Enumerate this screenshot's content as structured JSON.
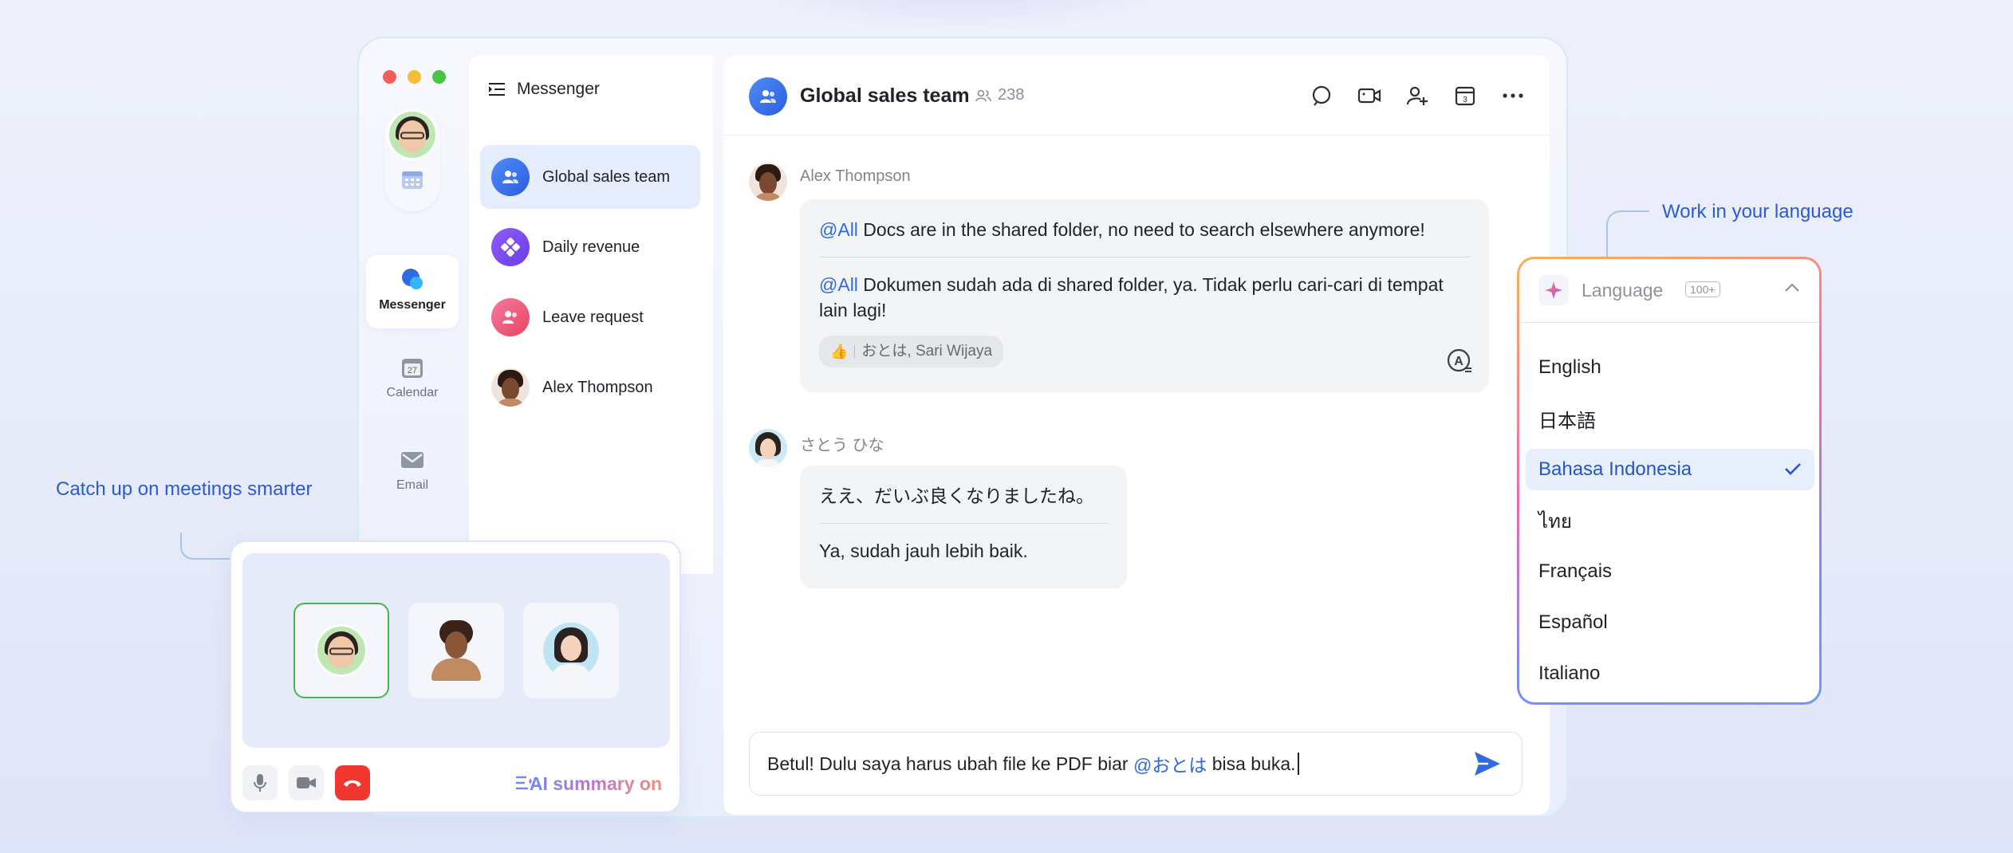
{
  "app": {
    "title": "Messenger",
    "rail": [
      {
        "label": "Messenger",
        "icon": "messenger-icon"
      },
      {
        "label": "Calendar",
        "icon": "calendar-icon",
        "day": "27"
      },
      {
        "label": "Email",
        "icon": "email-icon"
      }
    ]
  },
  "chat_list": [
    {
      "name": "Global sales team",
      "icon": "group-icon",
      "color": "#3a6fe8"
    },
    {
      "name": "Daily revenue",
      "icon": "revenue-icon",
      "color": "#7a4cf0"
    },
    {
      "name": "Leave request",
      "icon": "leave-request-icon",
      "color": "#ee5a7d"
    },
    {
      "name": "Alex Thompson",
      "icon": "avatar"
    }
  ],
  "conversation": {
    "title": "Global sales team",
    "member_count": "238",
    "calendar_day": "3",
    "messages": [
      {
        "sender": "Alex Thompson",
        "mention": "@All",
        "text_original": " Docs are in the shared folder, no need to search elsewhere anymore!",
        "text_translated": " Dokumen sudah ada di shared folder, ya. Tidak perlu cari-cari di tempat lain lagi!",
        "reaction": "おとは, Sari Wijaya"
      },
      {
        "sender": "さとう ひな",
        "text_original": "ええ、だいぶ良くなりましたね。",
        "text_translated": "Ya, sudah jauh lebih baik."
      }
    ],
    "input": {
      "before": "Betul! Dulu saya harus ubah file ke PDF biar ",
      "mention": "@おとは",
      "after": " bisa buka."
    }
  },
  "call": {
    "ai_summary_label": "AI summary on"
  },
  "callouts": {
    "meetings": "Catch up on meetings smarter",
    "language": "Work in your language"
  },
  "language_panel": {
    "title": "Language",
    "badge": "100+",
    "options": [
      "English",
      "日本語",
      "Bahasa Indonesia",
      "ไทย",
      "Français",
      "Español",
      "Italiano"
    ],
    "selected": "Bahasa Indonesia"
  },
  "colors": {
    "accent": "#2f6ae0",
    "callout": "#2b5bd2",
    "hangup": "#f0362f",
    "active_border": "#46b74a"
  }
}
